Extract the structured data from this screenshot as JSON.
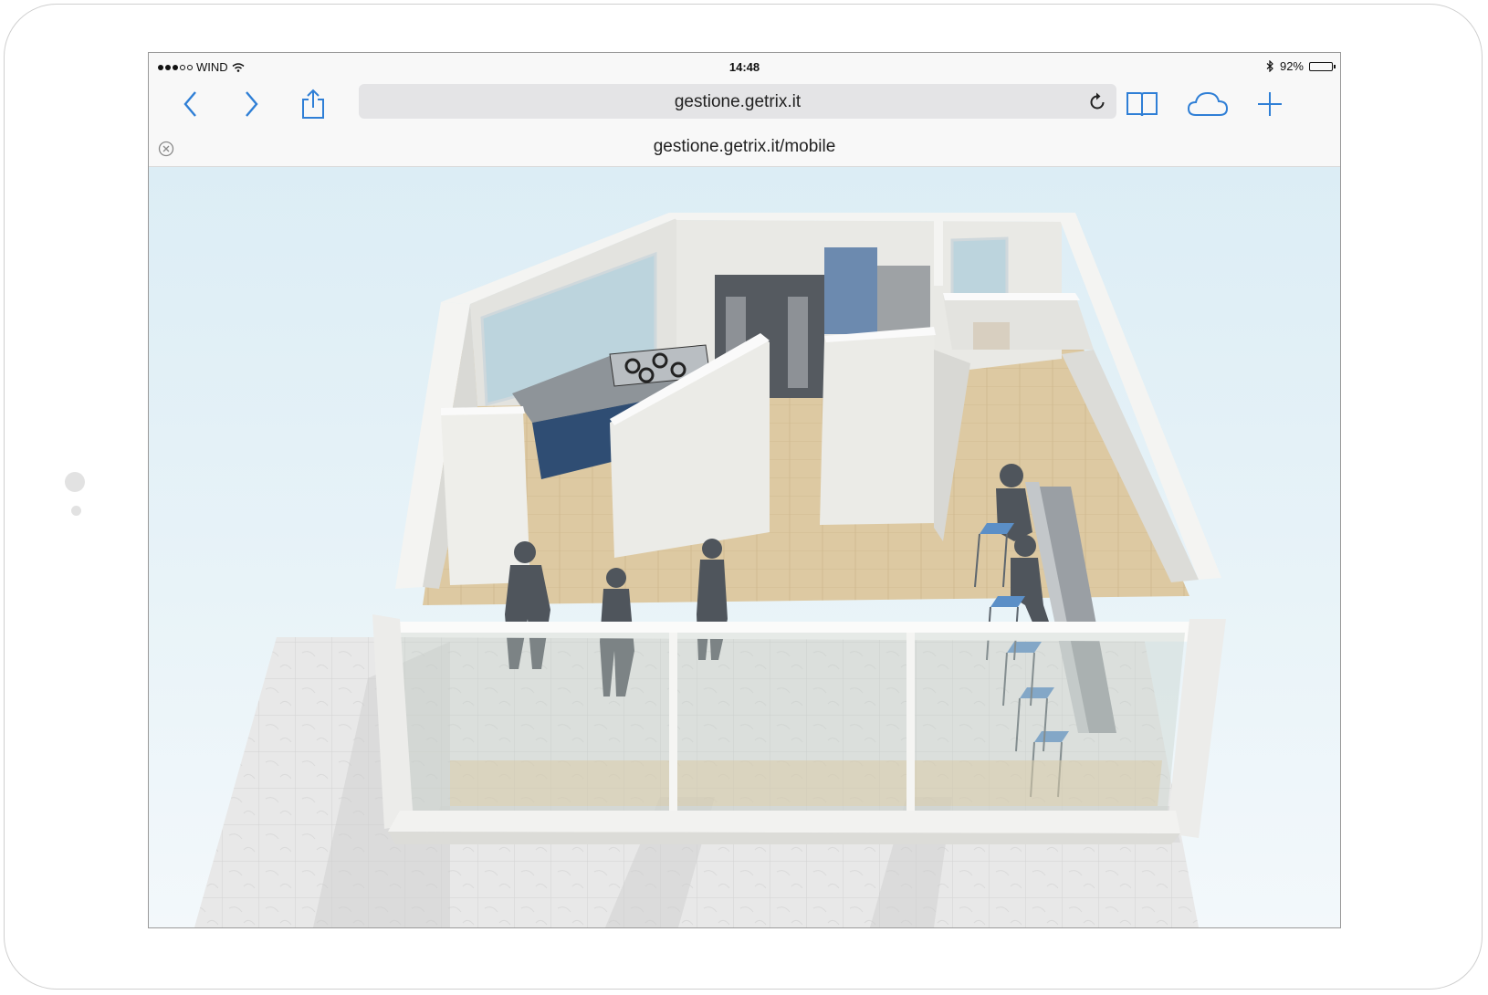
{
  "status": {
    "carrier": "WIND",
    "time": "14:48",
    "battery": "92%",
    "battery_level": 0.92
  },
  "toolbar": {
    "url": "gestione.getrix.it"
  },
  "tab": {
    "title": "gestione.getrix.it/mobile"
  },
  "icons": {
    "back": "chevron-left-icon",
    "forward": "chevron-right-icon",
    "share": "share-icon",
    "reload": "reload-icon",
    "bookmarks": "book-icon",
    "cloud": "cloud-icon",
    "new_tab": "plus-icon",
    "close_tab": "close-circle-icon",
    "wifi": "wifi-icon",
    "bluetooth": "bluetooth-icon"
  },
  "colors": {
    "accent": "#2f7fd6",
    "chrome": "#f8f8f8"
  }
}
